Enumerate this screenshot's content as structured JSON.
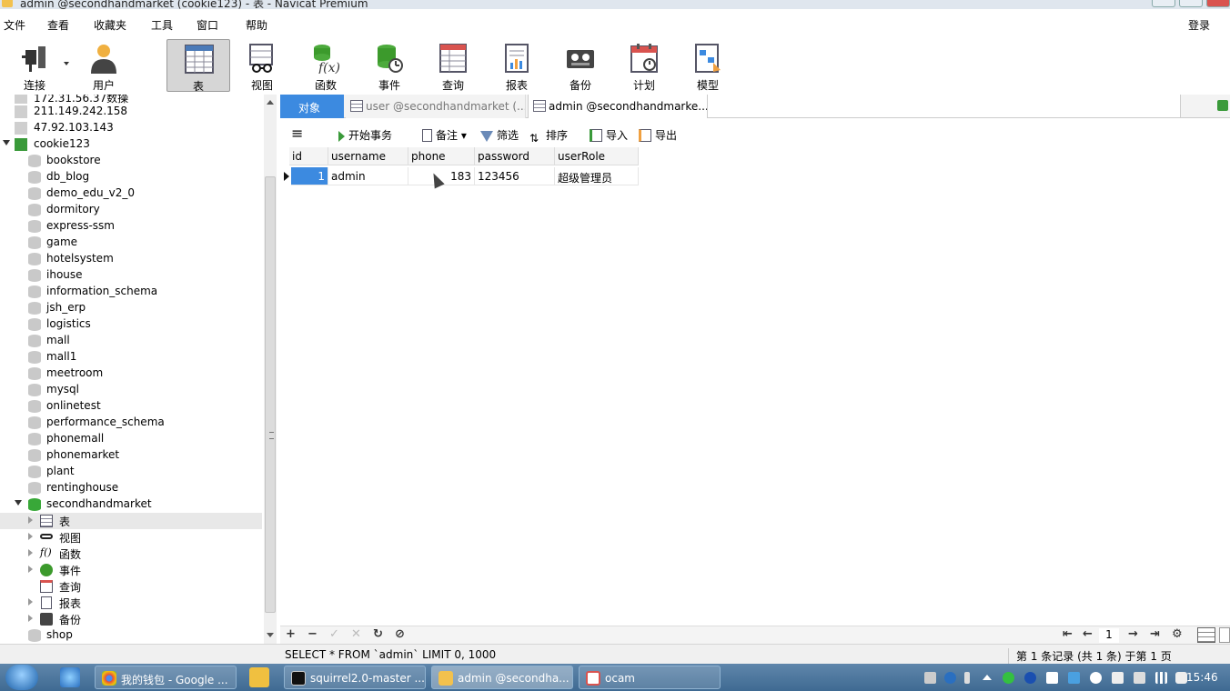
{
  "window": {
    "title": "admin @secondhandmarket (cookie123) - 表 - Navicat Premium"
  },
  "menu": {
    "items": [
      "文件",
      "查看",
      "收藏夹",
      "工具",
      "窗口",
      "帮助"
    ],
    "login": "登录"
  },
  "toolbar": {
    "buttons": [
      {
        "label": "连接",
        "icon": "plug-icon"
      },
      {
        "label": "用户",
        "icon": "user-icon"
      },
      {
        "label": "表",
        "icon": "table-icon"
      },
      {
        "label": "视图",
        "icon": "view-icon"
      },
      {
        "label": "函数",
        "icon": "function-icon"
      },
      {
        "label": "事件",
        "icon": "event-icon"
      },
      {
        "label": "查询",
        "icon": "query-icon"
      },
      {
        "label": "报表",
        "icon": "report-icon"
      },
      {
        "label": "备份",
        "icon": "backup-icon"
      },
      {
        "label": "计划",
        "icon": "schedule-icon"
      },
      {
        "label": "模型",
        "icon": "model-icon"
      }
    ]
  },
  "sidebar": {
    "connections": [
      "172.31.56.37数操",
      "211.149.242.158",
      "47.92.103.143",
      "cookie123"
    ],
    "databases": [
      "bookstore",
      "db_blog",
      "demo_edu_v2_0",
      "dormitory",
      "express-ssm",
      "game",
      "hotelsystem",
      "ihouse",
      "information_schema",
      "jsh_erp",
      "logistics",
      "mall",
      "mall1",
      "meetroom",
      "mysql",
      "onlinetest",
      "performance_schema",
      "phonemall",
      "phonemarket",
      "plant",
      "rentinghouse",
      "secondhandmarket"
    ],
    "db_children": [
      "表",
      "视图",
      "函数",
      "事件",
      "查询",
      "报表",
      "备份"
    ],
    "last_db": "shop"
  },
  "tabs": {
    "objects": "对象",
    "tab1": "user @secondhandmarket (...",
    "tab2": "admin @secondhandmarke..."
  },
  "datatoolbar": {
    "menu": "≡",
    "begin_tx": "开始事务",
    "note": "备注",
    "filter": "筛选",
    "sort": "排序",
    "import": "导入",
    "export": "导出"
  },
  "grid": {
    "columns": [
      "id",
      "username",
      "phone",
      "password",
      "userRole"
    ],
    "rows": [
      [
        "1",
        "admin",
        "183",
        "123456",
        "超级管理员"
      ]
    ]
  },
  "nav": {
    "add": "+",
    "remove": "−",
    "confirm": "✓",
    "cancel": "✕",
    "refresh": "↻",
    "stop": "⊘",
    "first": "⇤",
    "prev": "←",
    "page": "1",
    "next": "→",
    "last": "⇥",
    "settings": "⚙"
  },
  "status": {
    "sql": "SELECT * FROM `admin` LIMIT 0, 1000",
    "record_info": "第 1 条记录 (共 1 条) 于第 1 页"
  },
  "taskbar": {
    "items": [
      "我的钱包 - Google ...",
      "squirrel2.0-master ...",
      "admin @secondha...",
      "ocam"
    ],
    "clock": "15:46"
  },
  "colors": {
    "accent": "#3c8ae0",
    "taskbar": "#4f789f"
  }
}
